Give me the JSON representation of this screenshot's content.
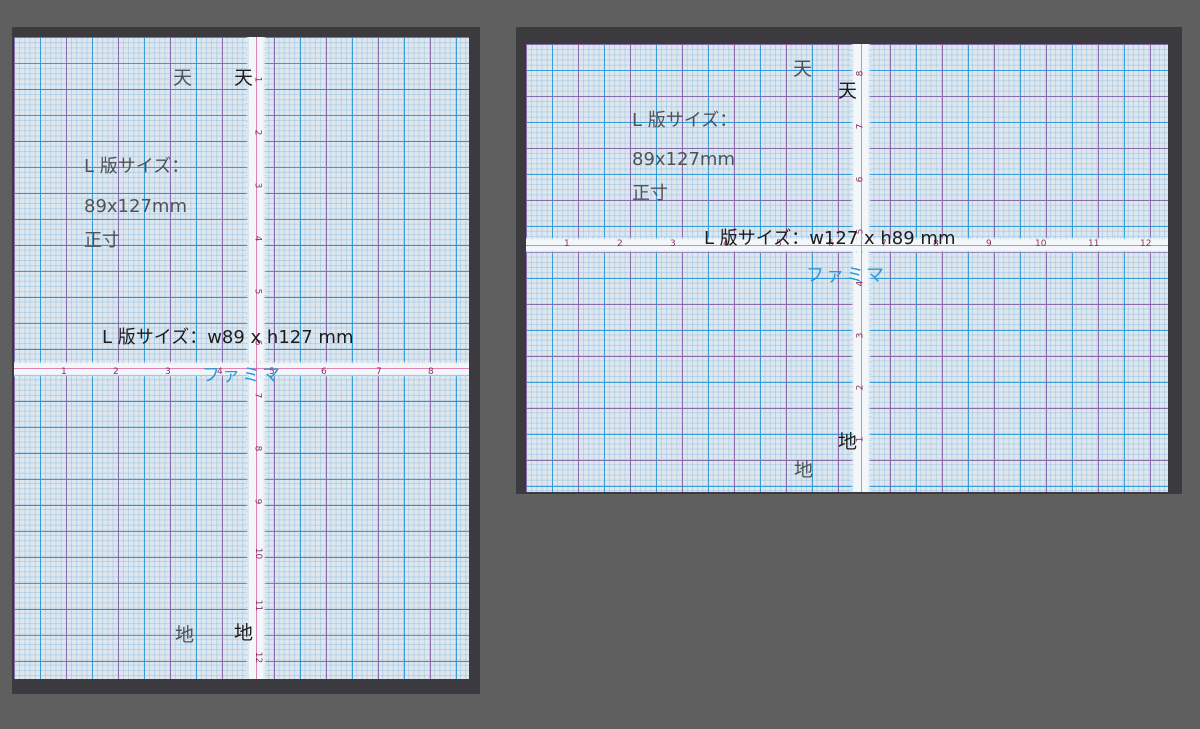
{
  "portrait": {
    "top_labels": [
      "天",
      "天"
    ],
    "bottom_labels": [
      "地",
      "地"
    ],
    "info_lines": [
      "L 版サイズ：",
      "89x127mm",
      "正寸"
    ],
    "size_label": "L 版サイズ：w89 x h127 mm",
    "brand": "ファミマ",
    "ruler_h": [
      "1",
      "2",
      "3",
      "4",
      "5",
      "6",
      "7",
      "8"
    ],
    "ruler_v": [
      "1",
      "2",
      "3",
      "4",
      "5",
      "6",
      "7",
      "8",
      "9",
      "10",
      "11",
      "12"
    ]
  },
  "landscape": {
    "top_labels": [
      "天",
      "天"
    ],
    "bottom_labels": [
      "地",
      "地"
    ],
    "info_lines": [
      "L 版サイズ：",
      "89x127mm",
      "正寸"
    ],
    "size_label": "L 版サイズ：w127 x h89 mm",
    "brand": "ファミマ",
    "ruler_h": [
      "1",
      "2",
      "3",
      "4",
      "5",
      "6",
      "7",
      "8",
      "9",
      "10",
      "11",
      "12"
    ],
    "ruler_v": [
      "8",
      "7",
      "6",
      "5",
      "4",
      "3",
      "2",
      "1"
    ]
  },
  "colors": {
    "canvas": "#5f5f5f",
    "artboard": "#3b3b3f",
    "paper": "#dfe7ee",
    "grid_blue": "#2896d7",
    "grid_pink": "#c8468c",
    "brand": "#2a9ad6"
  }
}
